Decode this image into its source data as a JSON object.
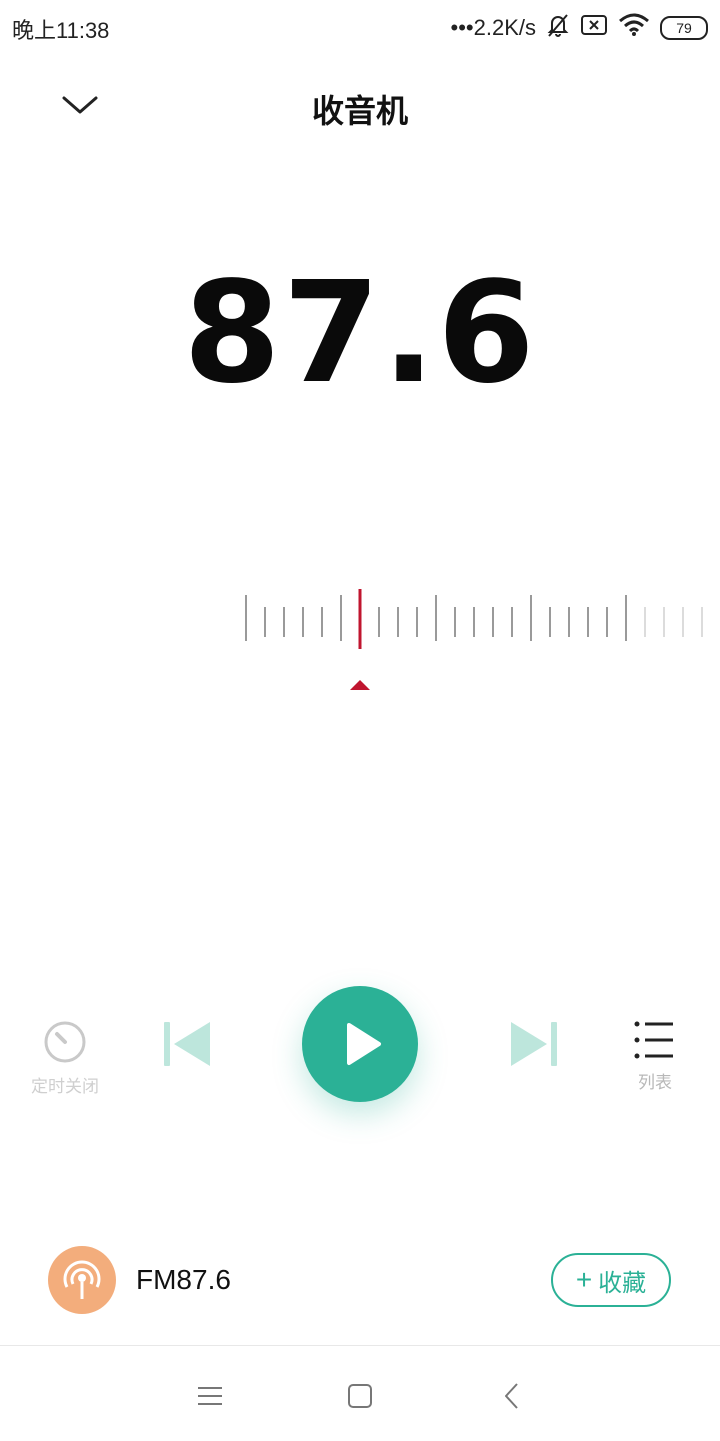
{
  "status_bar": {
    "time": "晚上11:38",
    "network_speed": "•••2.2K/s",
    "battery": "79",
    "icons": [
      "mute-bell-icon",
      "sim-x-icon",
      "wifi-icon",
      "battery-icon"
    ]
  },
  "header": {
    "title": "收音机",
    "collapse_icon": "chevron-down-icon"
  },
  "frequency": {
    "display": "87.6"
  },
  "dial": {
    "indicator_color": "#c0152f"
  },
  "controls": {
    "timer_label": "定时关闭",
    "list_label": "列表",
    "accent_color": "#2bb196",
    "icons": [
      "timer-icon",
      "previous-icon",
      "play-icon",
      "next-icon",
      "list-icon"
    ]
  },
  "station": {
    "name": "FM87.6",
    "favorite_label": "收藏",
    "favorite_plus": "+",
    "logo_icon": "radio-antenna-icon",
    "logo_color": "#f3ad7c"
  },
  "nav_bar": {
    "icons": [
      "menu-icon",
      "home-icon",
      "back-icon"
    ]
  }
}
